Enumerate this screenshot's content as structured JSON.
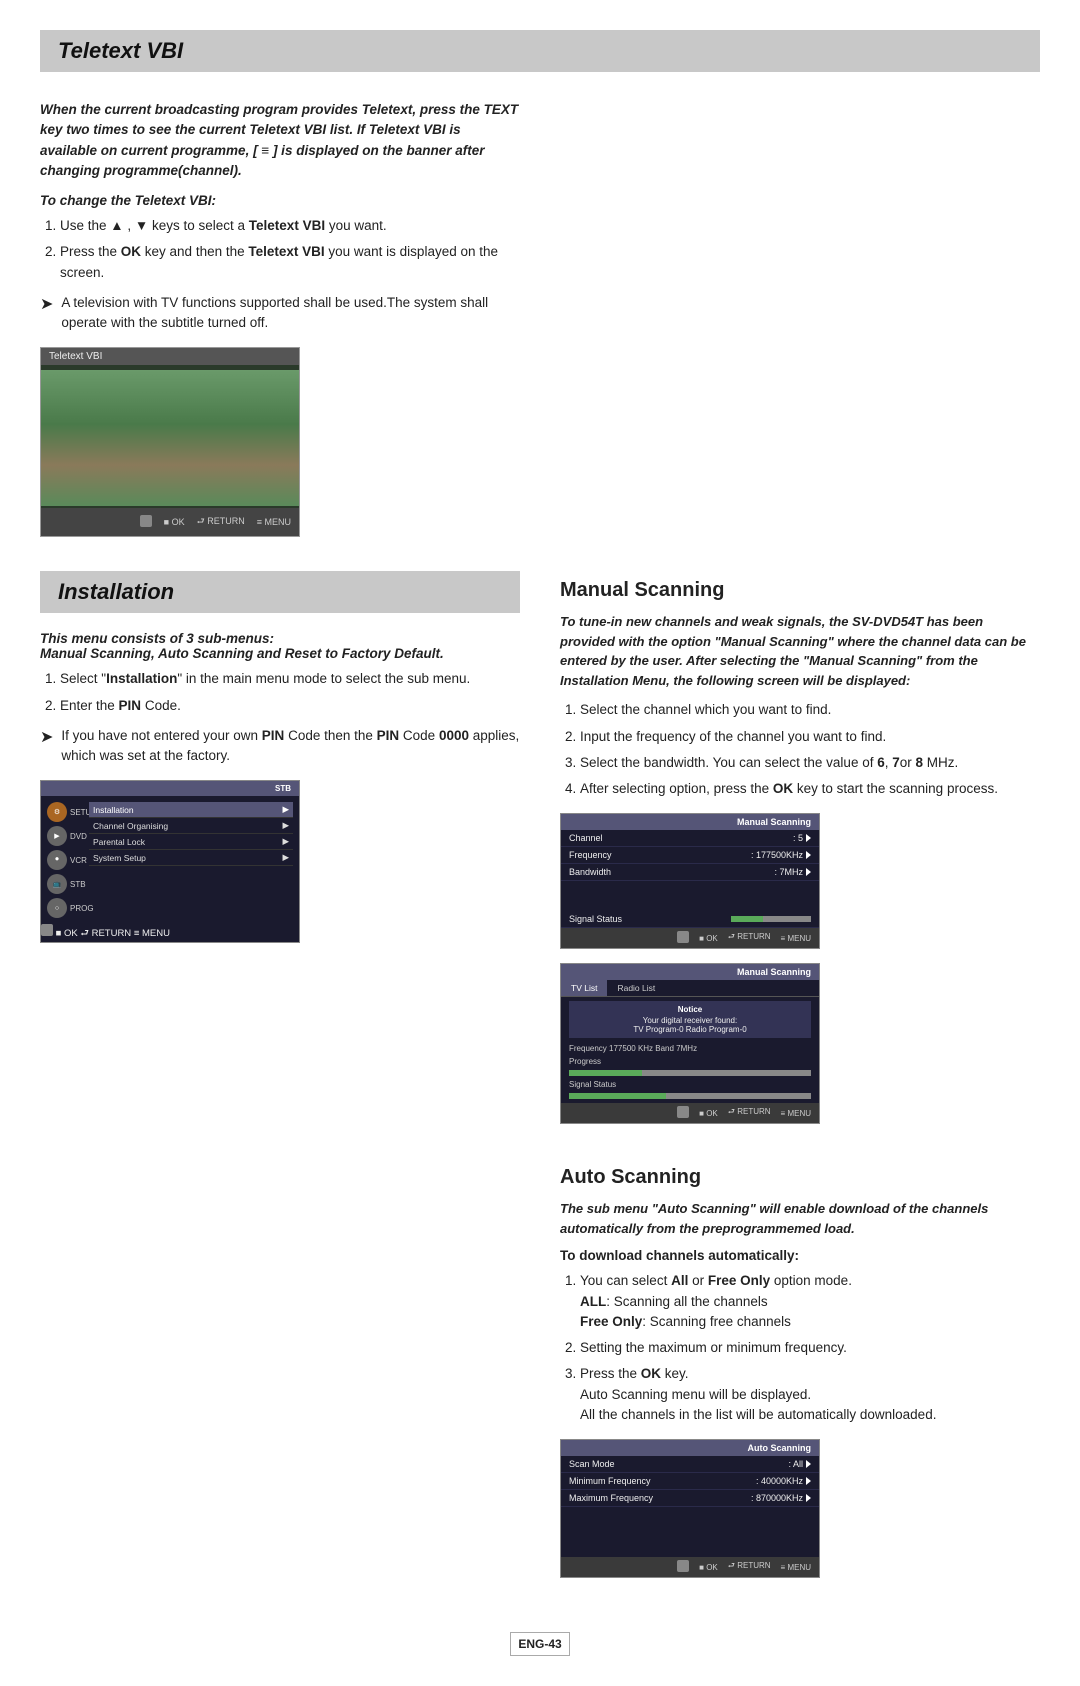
{
  "teletext_section": {
    "title": "Teletext VBI",
    "intro": "When the current broadcasting program provides Teletext, press the TEXT key two times to see the current Teletext VBI list. If Teletext VBI is available on current programme, [ ≡ ] is displayed on the banner after changing programme(channel).",
    "subsection_title": "To change the Teletext VBI:",
    "steps": [
      "Use the ▲ , ▼ keys to select a Teletext VBI you want.",
      "Press the OK key and then the Teletext VBI you want is displayed on the screen."
    ],
    "note": "A television with TV functions supported shall be used.The system shall operate with the subtitle turned off."
  },
  "installation_section": {
    "title": "Installation",
    "intro_bold": "This menu consists of 3 sub-menus: Manual Scanning, Auto Scanning and Reset to Factory Default.",
    "steps": [
      "Select \"Installation\" in the main menu mode to select the sub menu.",
      "Enter the PIN Code."
    ],
    "note": "If you have not entered your own PIN Code then the PIN Code 0000 applies, which was set at the factory."
  },
  "manual_scanning_section": {
    "title": "Manual Scanning",
    "intro": "To tune-in new channels and weak signals, the SV-DVD54T has been provided with the option \"Manual Scanning\" where the channel data can be entered by the user. After selecting the \"Manual Scanning\" from the Installation Menu, the following screen will be displayed:",
    "steps": [
      "Select the channel which you want to find.",
      "Input the frequency of the channel you want to find.",
      "Select the bandwidth. You can select the value of 6, 7or 8 MHz.",
      "After selecting option, press the OK key to start the scanning process."
    ],
    "menu1": {
      "title": "Manual Scanning",
      "rows": [
        {
          "label": "Channel",
          "value": ": 5"
        },
        {
          "label": "Frequency",
          "value": ": 177500KHz"
        },
        {
          "label": "Bandwidth",
          "value": ": 7MHz"
        }
      ],
      "signal_label": "Signal Status"
    },
    "menu2": {
      "title": "Manual Scanning",
      "tabs": [
        "TV List",
        "Radio List"
      ],
      "notice_title": "Notice",
      "notice_text": "Your digital receiver found:\nTV Program-0 Radio Program-0",
      "freq_text": "Frequency 177500 KHz Band 7MHz",
      "progress_label": "Progress",
      "signal_label": "Signal Status"
    }
  },
  "auto_scanning_section": {
    "title": "Auto Scanning",
    "intro": "The sub menu \"Auto Scanning\" will enable download of the channels automatically from the preprogrammemed load.",
    "download_title": "To download channels automatically:",
    "steps": [
      "You can select All or Free Only option mode. ALL: Scanning all the channels\nFree Only: Scanning free channels",
      "Setting the maximum or minimum frequency.",
      "Press the OK key.\nAuto Scanning menu will be displayed.\nAll the channels in the list will be automatically downloaded."
    ],
    "menu": {
      "title": "Auto Scanning",
      "rows": [
        {
          "label": "Scan Mode",
          "value": ": All"
        },
        {
          "label": "Minimum Frequency",
          "value": ": 40000KHz"
        },
        {
          "label": "Maximum Frequency",
          "value": ": 870000KHz"
        }
      ]
    }
  },
  "setup_menu": {
    "badge": "STB",
    "icons": [
      "SETUP",
      "DVD",
      "VCR",
      "STB",
      "PROG"
    ],
    "items": [
      "Installation",
      "Channel Organising",
      "Parental Lock",
      "System Setup"
    ]
  },
  "page_number": "ENG-43",
  "footer_buttons": {
    "ok": "OK",
    "return": "RETURN",
    "menu": "MENU"
  }
}
